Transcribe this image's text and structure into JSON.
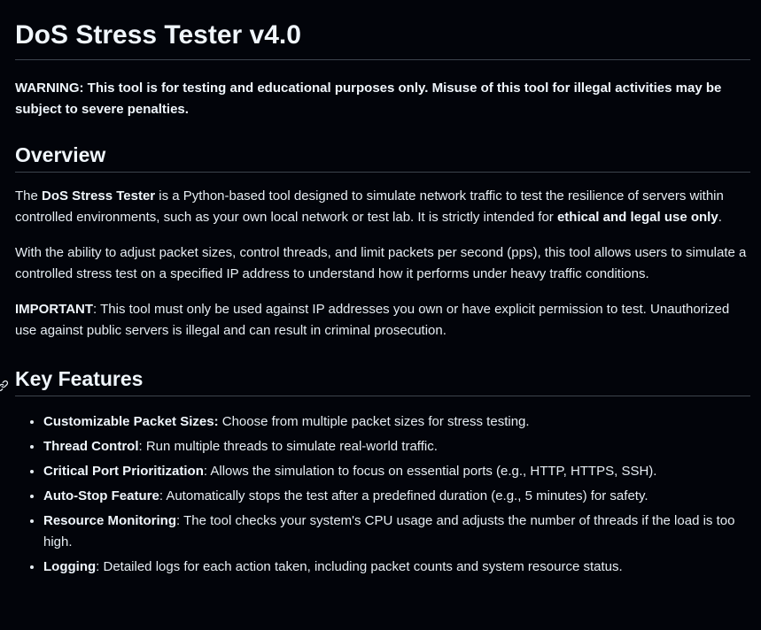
{
  "title": "DoS Stress Tester v4.0",
  "warning": "WARNING: This tool is for testing and educational purposes only. Misuse of this tool for illegal activities may be subject to severe penalties.",
  "overview": {
    "heading": "Overview",
    "p1": {
      "pre": "The ",
      "bold1": "DoS Stress Tester",
      "mid": " is a Python-based tool designed to simulate network traffic to test the resilience of servers within controlled environments, such as your own local network or test lab. It is strictly intended for ",
      "bold2": "ethical and legal use only",
      "post": "."
    },
    "p2": "With the ability to adjust packet sizes, control threads, and limit packets per second (pps), this tool allows users to simulate a controlled stress test on a specified IP address to understand how it performs under heavy traffic conditions.",
    "p3": {
      "bold": "IMPORTANT",
      "text": ": This tool must only be used against IP addresses you own or have explicit permission to test. Unauthorized use against public servers is illegal and can result in criminal prosecution."
    }
  },
  "features": {
    "heading": "Key Features",
    "items": [
      {
        "bold": "Customizable Packet Sizes:",
        "text": " Choose from multiple packet sizes for stress testing."
      },
      {
        "bold": "Thread Control",
        "text": ": Run multiple threads to simulate real-world traffic."
      },
      {
        "bold": "Critical Port Prioritization",
        "text": ": Allows the simulation to focus on essential ports (e.g., HTTP, HTTPS, SSH)."
      },
      {
        "bold": "Auto-Stop Feature",
        "text": ": Automatically stops the test after a predefined duration (e.g., 5 minutes) for safety."
      },
      {
        "bold": "Resource Monitoring",
        "text": ": The tool checks your system's CPU usage and adjusts the number of threads if the load is too high."
      },
      {
        "bold": "Logging",
        "text": ": Detailed logs for each action taken, including packet counts and system resource status."
      }
    ]
  }
}
